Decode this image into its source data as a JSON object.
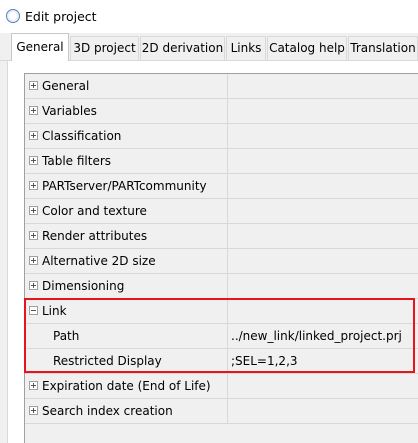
{
  "window": {
    "title": "Edit project"
  },
  "tabs": [
    {
      "label": "General"
    },
    {
      "label": "3D project"
    },
    {
      "label": "2D derivation"
    },
    {
      "label": "Links"
    },
    {
      "label": "Catalog help"
    },
    {
      "label": "Translation"
    }
  ],
  "property_grid": {
    "groups": [
      {
        "label": "General"
      },
      {
        "label": "Variables"
      },
      {
        "label": "Classification"
      },
      {
        "label": "Table filters"
      },
      {
        "label": "PARTserver/PARTcommunity"
      },
      {
        "label": "Color and texture"
      },
      {
        "label": "Render attributes"
      },
      {
        "label": "Alternative 2D size"
      },
      {
        "label": "Dimensioning"
      },
      {
        "label": "Link"
      },
      {
        "label": "Expiration date (End of Life)"
      },
      {
        "label": "Search index creation"
      }
    ],
    "link_children": [
      {
        "label": "Path",
        "value": "../new_link/linked_project.prj"
      },
      {
        "label": "Restricted Display",
        "value": ";SEL=1,2,3"
      }
    ]
  },
  "colors": {
    "highlight": "#e8141b",
    "grid_background": "#f0f0f0",
    "grid_lines": "#d8d8d8"
  }
}
